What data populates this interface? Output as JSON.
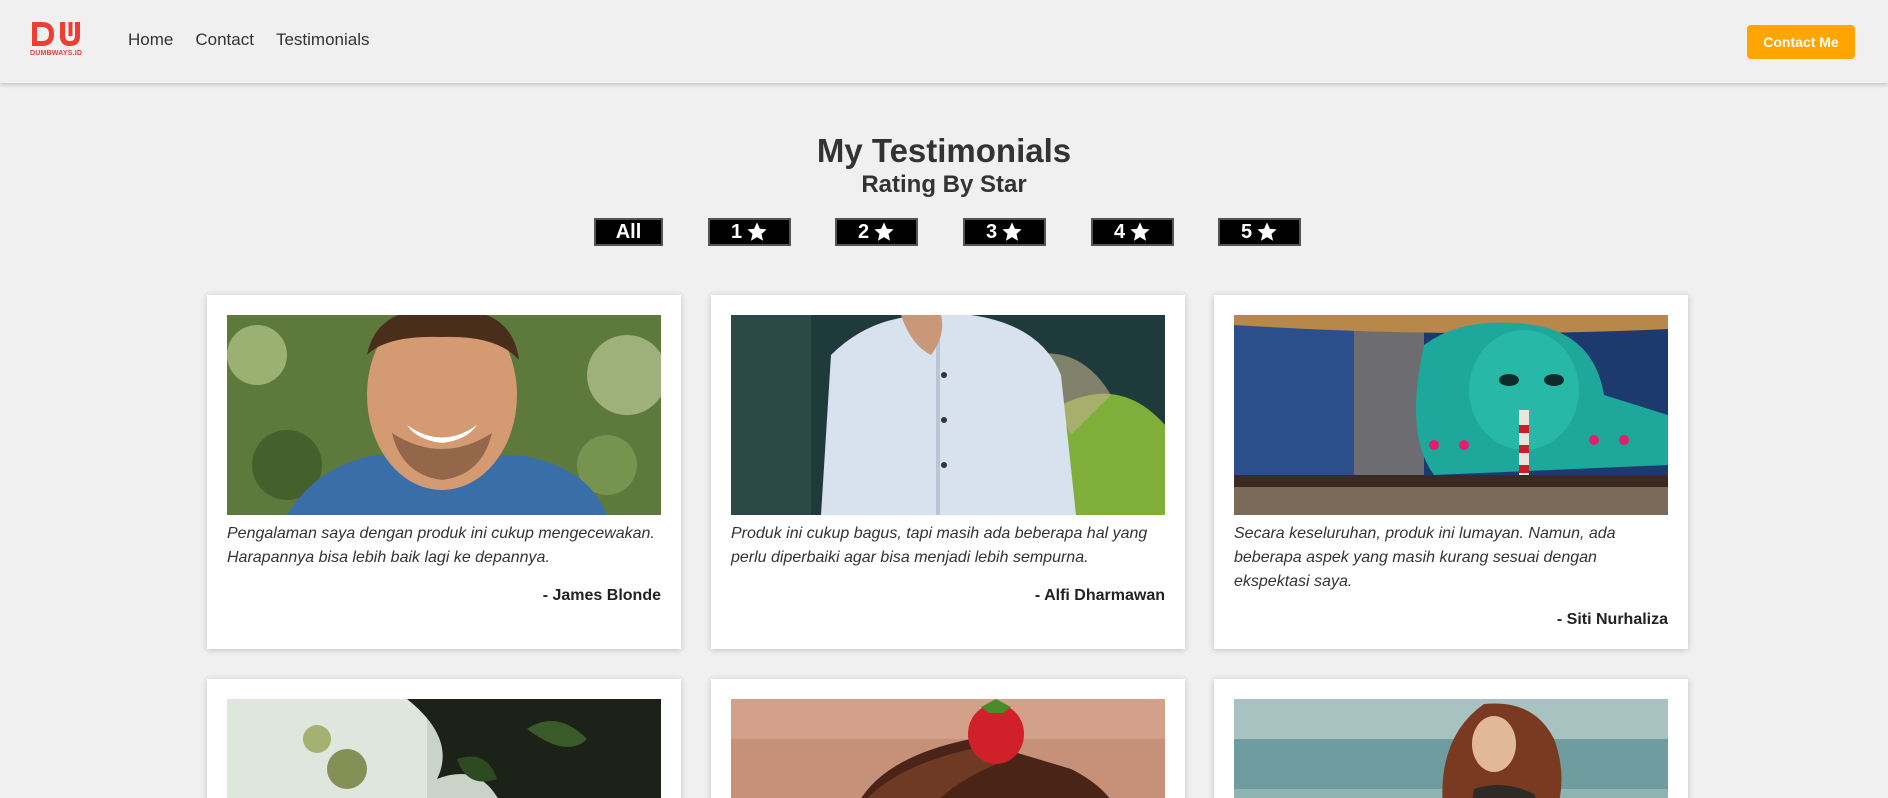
{
  "navbar": {
    "logo_text": "DUMBWAYS.ID",
    "links": [
      "Home",
      "Contact",
      "Testimonials"
    ],
    "cta": "Contact Me",
    "brand_color": "#ee3e34",
    "cta_color": "#ffa500"
  },
  "header": {
    "title": "My Testimonials",
    "subtitle": "Rating By Star"
  },
  "filters": [
    {
      "label": "All",
      "icon": null
    },
    {
      "label": "1",
      "icon": "star-icon"
    },
    {
      "label": "2",
      "icon": "star-icon"
    },
    {
      "label": "3",
      "icon": "star-icon"
    },
    {
      "label": "4",
      "icon": "star-icon"
    },
    {
      "label": "5",
      "icon": "star-icon"
    }
  ],
  "testimonials": [
    {
      "quote": "Pengalaman saya dengan produk ini cukup mengecewakan. Harapannya bisa lebih baik lagi ke depannya.",
      "author": "- James Blonde",
      "image": "smiling-man-photo"
    },
    {
      "quote": "Produk ini cukup bagus, tapi masih ada beberapa hal yang perlu diperbaiki agar bisa menjadi lebih sempurna.",
      "author": "- Alfi Dharmawan",
      "image": "man-in-shirt-photo"
    },
    {
      "quote": "Secara keseluruhan, produk ini lumayan. Namun, ada beberapa aspek yang masih kurang sesuai dengan ekspektasi saya.",
      "author": "- Siti Nurhaliza",
      "image": "street-mural-photo"
    },
    {
      "quote": "",
      "author": "",
      "image": "foliage-photo"
    },
    {
      "quote": "",
      "author": "",
      "image": "chocolate-cake-photo"
    },
    {
      "quote": "",
      "author": "",
      "image": "woman-by-sea-photo"
    }
  ]
}
